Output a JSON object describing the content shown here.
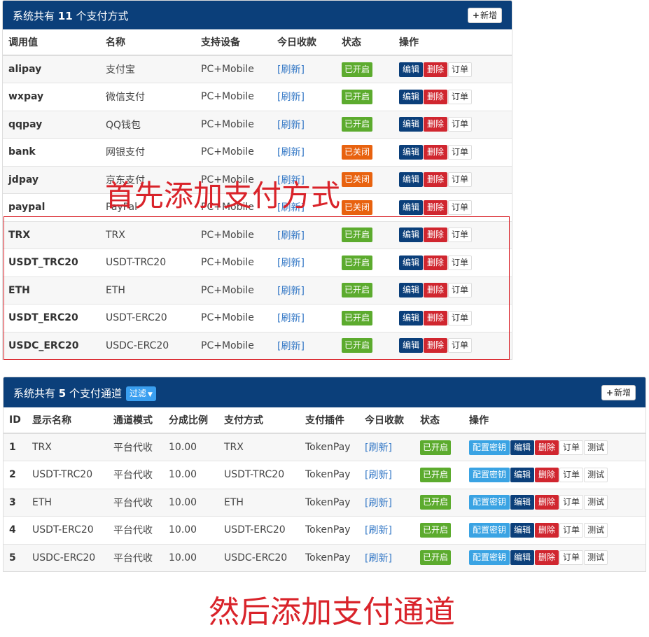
{
  "panel1": {
    "title_prefix": "系统共有",
    "title_count": "11",
    "title_suffix": "个支付方式",
    "add_label": "新增",
    "headers": [
      "调用值",
      "名称",
      "支持设备",
      "今日收款",
      "状态",
      "操作"
    ],
    "rows": [
      {
        "code": "alipay",
        "name": "支付宝",
        "device": "PC+Mobile",
        "income": "[刷新]",
        "status": "已开启",
        "status_type": "on"
      },
      {
        "code": "wxpay",
        "name": "微信支付",
        "device": "PC+Mobile",
        "income": "[刷新]",
        "status": "已开启",
        "status_type": "on"
      },
      {
        "code": "qqpay",
        "name": "QQ钱包",
        "device": "PC+Mobile",
        "income": "[刷新]",
        "status": "已开启",
        "status_type": "on"
      },
      {
        "code": "bank",
        "name": "网银支付",
        "device": "PC+Mobile",
        "income": "[刷新]",
        "status": "已关闭",
        "status_type": "off"
      },
      {
        "code": "jdpay",
        "name": "京东支付",
        "device": "PC+Mobile",
        "income": "[刷新]",
        "status": "已关闭",
        "status_type": "off"
      },
      {
        "code": "paypal",
        "name": "PayPal",
        "device": "PC+Mobile",
        "income": "[刷新]",
        "status": "已关闭",
        "status_type": "off"
      },
      {
        "code": "TRX",
        "name": "TRX",
        "device": "PC+Mobile",
        "income": "[刷新]",
        "status": "已开启",
        "status_type": "on"
      },
      {
        "code": "USDT_TRC20",
        "name": "USDT-TRC20",
        "device": "PC+Mobile",
        "income": "[刷新]",
        "status": "已开启",
        "status_type": "on"
      },
      {
        "code": "ETH",
        "name": "ETH",
        "device": "PC+Mobile",
        "income": "[刷新]",
        "status": "已开启",
        "status_type": "on"
      },
      {
        "code": "USDT_ERC20",
        "name": "USDT-ERC20",
        "device": "PC+Mobile",
        "income": "[刷新]",
        "status": "已开启",
        "status_type": "on"
      },
      {
        "code": "USDC_ERC20",
        "name": "USDC-ERC20",
        "device": "PC+Mobile",
        "income": "[刷新]",
        "status": "已开启",
        "status_type": "on"
      }
    ],
    "actions": {
      "edit": "编辑",
      "delete": "删除",
      "orders": "订单"
    }
  },
  "panel2": {
    "title_prefix": "系统共有",
    "title_count": "5",
    "title_suffix": "个支付通道",
    "filter_label": "过滤",
    "add_label": "新增",
    "headers": [
      "ID",
      "显示名称",
      "通道模式",
      "分成比例",
      "支付方式",
      "支付插件",
      "今日收款",
      "状态",
      "操作"
    ],
    "rows": [
      {
        "id": "1",
        "name": "TRX",
        "mode": "平台代收",
        "rate": "10.00",
        "method": "TRX",
        "plugin": "TokenPay",
        "income": "[刷新]",
        "status": "已开启"
      },
      {
        "id": "2",
        "name": "USDT-TRC20",
        "mode": "平台代收",
        "rate": "10.00",
        "method": "USDT-TRC20",
        "plugin": "TokenPay",
        "income": "[刷新]",
        "status": "已开启"
      },
      {
        "id": "3",
        "name": "ETH",
        "mode": "平台代收",
        "rate": "10.00",
        "method": "ETH",
        "plugin": "TokenPay",
        "income": "[刷新]",
        "status": "已开启"
      },
      {
        "id": "4",
        "name": "USDT-ERC20",
        "mode": "平台代收",
        "rate": "10.00",
        "method": "USDT-ERC20",
        "plugin": "TokenPay",
        "income": "[刷新]",
        "status": "已开启"
      },
      {
        "id": "5",
        "name": "USDC-ERC20",
        "mode": "平台代收",
        "rate": "10.00",
        "method": "USDC-ERC20",
        "plugin": "TokenPay",
        "income": "[刷新]",
        "status": "已开启"
      }
    ],
    "actions": {
      "config_key": "配置密钥",
      "edit": "编辑",
      "delete": "删除",
      "orders": "订单",
      "test": "测试"
    }
  },
  "annotations": {
    "first": "首先添加支付方式",
    "second": "然后添加支付通道"
  },
  "colors": {
    "header_bg": "#0b3f7a",
    "status_on": "#5cab2e",
    "status_off": "#e8620f",
    "delete": "#d0262f",
    "config_key": "#3aa3e3",
    "annotation": "#d9232a"
  }
}
